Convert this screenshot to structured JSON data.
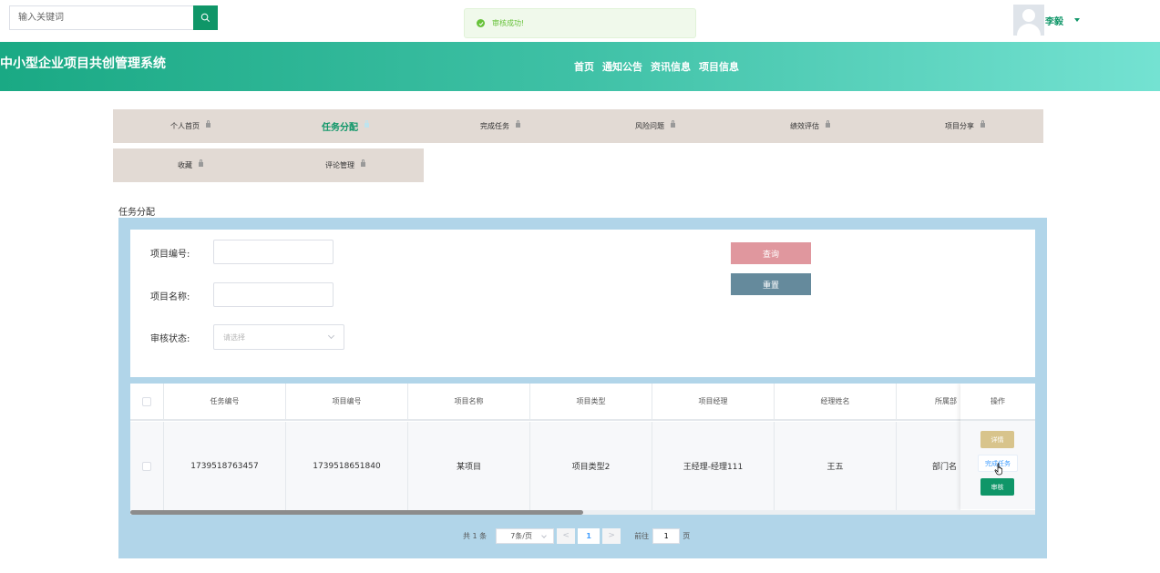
{
  "search": {
    "placeholder": "输入关键词"
  },
  "toast": {
    "message": "审核成功!"
  },
  "user": {
    "name": "李毅"
  },
  "header": {
    "site_title": "中小型企业项目共创管理系统",
    "nav": [
      "首页",
      "通知公告",
      "资讯信息",
      "项目信息"
    ]
  },
  "menu": {
    "row1": [
      "个人首页",
      "任务分配",
      "完成任务",
      "风险问题",
      "绩效评估",
      "项目分享"
    ],
    "row2": [
      "收藏",
      "评论管理"
    ],
    "active": "任务分配"
  },
  "page_title": "任务分配",
  "form": {
    "project_no_label": "项目编号:",
    "project_name_label": "项目名称:",
    "status_label": "审核状态:",
    "status_placeholder": "请选择",
    "query_label": "查询",
    "reset_label": "重置"
  },
  "table": {
    "columns": [
      "任务编号",
      "项目编号",
      "项目名称",
      "项目类型",
      "项目经理",
      "经理姓名",
      "所属部"
    ],
    "op_header": "操作",
    "rows": [
      {
        "task_no": "1739518763457",
        "project_no": "1739518651840",
        "project_name": "某项目",
        "project_type": "项目类型2",
        "manager": "王经理-经理111",
        "manager_name": "王五",
        "department": "部门名"
      }
    ],
    "actions": {
      "detail": "详情",
      "finish": "完成任务",
      "audit": "审核"
    },
    "scroll_fraction": 0.5
  },
  "pagination": {
    "total": "共 1 条",
    "page_size": "7条/页",
    "prev": "<",
    "current": "1",
    "next": ">",
    "goto_label": "前往",
    "goto_value": "1",
    "page_suffix": "页"
  },
  "colors": {
    "brand": "#0f9668",
    "header_gradient_start": "#1aa984",
    "header_gradient_end": "#74e2d2",
    "menu_bg": "#e2dad4",
    "panel_bg": "#b1d5e9",
    "query_button": "#e0979e",
    "reset_button": "#658a9c",
    "detail_button": "#d8c48c",
    "toast_bg": "#f0f9eb"
  }
}
